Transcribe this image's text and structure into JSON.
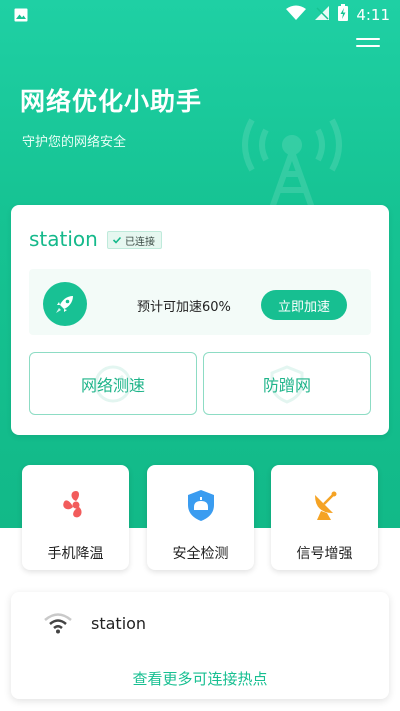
{
  "status_bar": {
    "time": "4:11"
  },
  "header": {
    "title": "网络优化小助手",
    "subtitle": "守护您的网络安全"
  },
  "main_card": {
    "ssid": "station",
    "connected_label": "已连接",
    "boost_text": "预计可加速60%",
    "boost_button": "立即加速",
    "speed_test_label": "网络测速",
    "anti_freeload_label": "防蹭网"
  },
  "features": [
    {
      "label": "手机降温",
      "icon": "fan-icon",
      "color": "#f25c5c"
    },
    {
      "label": "安全检测",
      "icon": "shield-icon",
      "color": "#3a9cf0"
    },
    {
      "label": "信号增强",
      "icon": "satellite-dish-icon",
      "color": "#f5a324"
    }
  ],
  "hotspots": {
    "items": [
      {
        "name": "station"
      }
    ],
    "more_link": "查看更多可连接热点"
  },
  "colors": {
    "accent": "#17bf91",
    "hero": "#1fd0a4"
  }
}
